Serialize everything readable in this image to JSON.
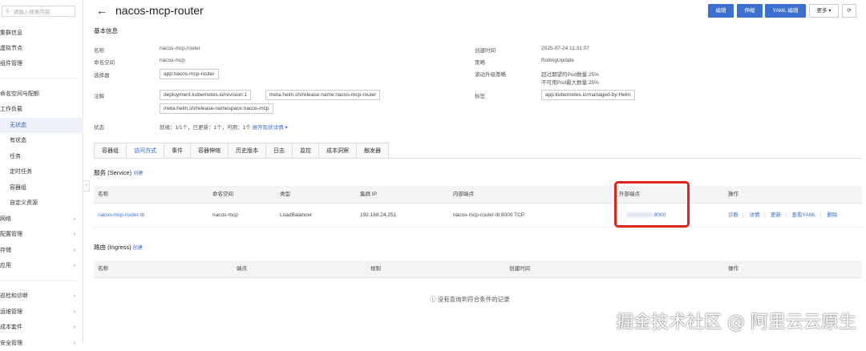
{
  "sidebar": {
    "search_placeholder": "请输入搜索内容",
    "items": [
      {
        "label": "集群信息"
      },
      {
        "label": "虚拟节点"
      },
      {
        "label": "组件管理"
      },
      {
        "label": "命名空间与配额"
      },
      {
        "label": "工作负载"
      },
      {
        "label": "无状态"
      },
      {
        "label": "有状态"
      },
      {
        "label": "任务"
      },
      {
        "label": "定时任务"
      },
      {
        "label": "容器组"
      },
      {
        "label": "自定义资源"
      },
      {
        "label": "网络"
      },
      {
        "label": "配置管理"
      },
      {
        "label": "存储"
      },
      {
        "label": "应用"
      },
      {
        "label": "巡检和诊断"
      },
      {
        "label": "运维管理"
      },
      {
        "label": "成本套件"
      },
      {
        "label": "安全管理"
      }
    ]
  },
  "header": {
    "back": "←",
    "title": "nacos-mcp-router",
    "buttons": {
      "edit": "编辑",
      "scale": "伸缩",
      "yaml": "YAML 编辑",
      "more": "更多",
      "refresh": "⟳"
    }
  },
  "basic": {
    "section": "基本信息",
    "name_label": "名称",
    "name": "nacos-mcp-router",
    "ns_label": "命名空间",
    "ns": "nacos-mcp",
    "selector_label": "选择器",
    "selector": "app:nacos-mcp-router",
    "annotations_label": "注解",
    "annotations": [
      "deployment.kubernetes.io/revision:1",
      "meta.helm.sh/release-name:nacos-mcp-router",
      "meta.helm.sh/release-namespace:nacos-mcp"
    ],
    "status_label": "状态",
    "status": "就绪：1/1个，已更新：1个，可用：1个",
    "status_link": "展开现状详情",
    "created_label": "创建时间",
    "created": "2025-07-24 11:31:07",
    "strategy_label": "策略",
    "strategy": "RollingUpdate",
    "rolling_label": "滚动升级策略",
    "rolling": [
      "超过期望的Pod数量:25%",
      "不可用Pod最大数量:25%"
    ],
    "labels_label": "标签",
    "labels": [
      "app.kubernetes.io/managed-by:Helm"
    ]
  },
  "tabs": [
    "容器组",
    "访问方式",
    "事件",
    "容器伸缩",
    "历史版本",
    "日志",
    "监控",
    "成本洞察",
    "触发器"
  ],
  "service": {
    "title": "服务 (Service)",
    "create": "创建",
    "columns": [
      "名称",
      "命名空间",
      "类型",
      "集群 IP",
      "内部端点",
      "外部端点",
      "操作"
    ],
    "rows": [
      {
        "name": "nacos-mcp-router-lb",
        "ns": "nacos-mcp",
        "type": "LoadBalancer",
        "ip": "192.168.24.251",
        "internal": "nacos-mcp-router-lb:8000 TCP",
        "external": ":8000",
        "actions": [
          "诊断",
          "详情",
          "更新",
          "查看YAML",
          "删除"
        ]
      }
    ]
  },
  "ingress": {
    "title": "路由 (Ingress)",
    "create": "创建",
    "columns": [
      "名称",
      "端点",
      "规则",
      "创建时间",
      "操作"
    ],
    "empty": "没有查询到符合条件的记录"
  },
  "watermark": "掘金技术社区 @ 阿里云云原生"
}
